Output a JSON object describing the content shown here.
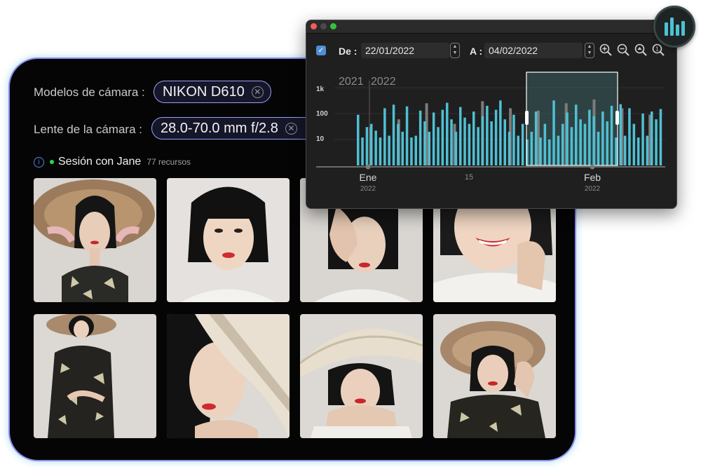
{
  "filters": {
    "camera_label": "Modelos de cámara :",
    "camera_value": "NIKON D610",
    "lens_label": "Lente de la cámara :",
    "lens_value": "28.0-70.0 mm f/2.8"
  },
  "session": {
    "info_icon": "info-icon",
    "name": "Sesión con Jane",
    "count": "77 recursos"
  },
  "photos": [
    {
      "label": "portrait-conical-hat-1"
    },
    {
      "label": "portrait-bob-hair"
    },
    {
      "label": "portrait-hand-on-head"
    },
    {
      "label": "portrait-smile-closeup"
    },
    {
      "label": "portrait-full-body-hat"
    },
    {
      "label": "portrait-hat-cover-face"
    },
    {
      "label": "portrait-hat-hands-chin"
    },
    {
      "label": "portrait-hat-hand-raised"
    }
  ],
  "timeline": {
    "enabled": true,
    "from_label": "De :",
    "from_value": "22/01/2022",
    "to_label": "A :",
    "to_value": "04/02/2022",
    "zoom_icons": [
      "zoom-in-icon",
      "zoom-out-icon",
      "zoom-fit-icon",
      "zoom-reset-icon"
    ],
    "accent": "#4fc0d4",
    "secondary_bar": "#7b7b7b",
    "selection_color": "#3c5f60"
  },
  "chart_data": {
    "type": "bar",
    "y_scale": "log",
    "y_ticks": [
      "1k",
      "100",
      "10"
    ],
    "year_markers": [
      "2021",
      "2022"
    ],
    "x_tick_labels": [
      {
        "month": "Ene",
        "year": "2022"
      },
      {
        "day": "15"
      },
      {
        "month": "Feb",
        "year": "2022"
      }
    ],
    "selection": {
      "from": "22/01/2022",
      "to": "04/02/2022"
    },
    "series": [
      {
        "values": [
          90,
          12,
          30,
          40,
          22,
          12,
          160,
          14,
          220,
          40,
          20,
          190,
          12,
          14,
          130,
          50,
          20,
          110,
          30,
          140,
          260,
          60,
          20,
          180,
          70,
          40,
          120,
          30,
          80,
          200,
          50,
          140,
          320,
          60,
          20,
          90,
          14,
          40,
          10,
          20,
          120,
          12,
          40,
          10,
          320,
          14,
          40,
          110,
          30,
          220,
          60,
          40,
          140,
          80,
          20,
          120,
          50,
          200,
          12,
          230,
          14,
          160,
          40,
          12,
          100,
          14,
          120,
          60,
          150
        ]
      },
      {
        "values": [
          30,
          60,
          250,
          40,
          300,
          160,
          130,
          250,
          350,
          160,
          90
        ]
      }
    ]
  },
  "app_badge_icon": "bar-chart-icon"
}
